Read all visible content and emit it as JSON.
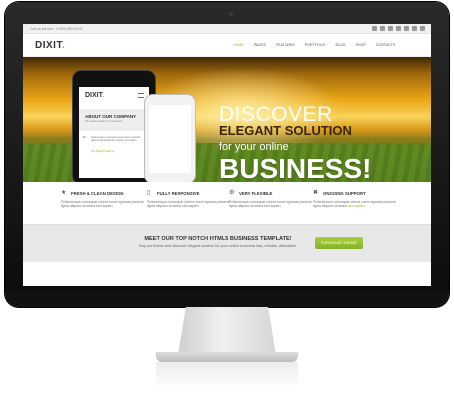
{
  "topbar": {
    "contact": "Call us toll free: +1 800 880 00 00",
    "social_icons": [
      "facebook-icon",
      "twitter-icon",
      "dribbble-icon",
      "linkedin-icon",
      "rss-icon",
      "skype-icon",
      "phone-icon"
    ]
  },
  "header": {
    "logo": "DIXIT",
    "logo_dot": ".",
    "nav": [
      "HOME",
      "PAGES",
      "FEATURES",
      "PORTFOLIO",
      "BLOG",
      "SHOP",
      "CONTACTS"
    ],
    "active_nav": "HOME"
  },
  "hero": {
    "discover": "DISCOVER",
    "elegant": "ELEGANT SOLUTION",
    "online": "for your online",
    "business": "BUSINESS!"
  },
  "phone": {
    "logo": "DIXIT",
    "logo_dot": ".",
    "about_title": "ABOUT OUR COMPANY",
    "about_sub": "We create solutions for business",
    "quote_text": "Pellentesque consequat viverra lorem egestas placerat ligula aliquam vivamus sed sapien.",
    "quote_author": "The Digital Thinker Inc."
  },
  "features": [
    {
      "icon": "star-icon",
      "title": "FRESH & CLEAN DESIGN",
      "text": "Pellentesque consequat viverra lorem egestas placerat ligula aliquam vivamus sed sapien."
    },
    {
      "icon": "mobile-icon",
      "title": "FULLY RESPONSIVE",
      "text": "Pellentesque consequat viverra lorem egestas placerat ligula aliquam vivamus sed sapien."
    },
    {
      "icon": "gear-icon",
      "title": "VERY FLEXIBLE",
      "text": "Pellentesque consequat viverra lorem egestas placerat ligula aliquam vivamus sed sapien."
    },
    {
      "icon": "support-icon",
      "title": "ONGOING SUPPORT",
      "text": "Pellentesque consequat viverra lorem egestas placerat ligula aliquam vivamus",
      "link": "sed sapien."
    }
  ],
  "cta": {
    "title": "MEET OUR TOP NOTCH HTML5 BUSINESS TEMPLATE!",
    "subtitle": "Buy our theme and discover elegant solution for your online business fast, reliable, affordable.",
    "button": "PURCHASE THEME!"
  },
  "colors": {
    "accent": "#8db72a",
    "bezel": "#111111"
  }
}
